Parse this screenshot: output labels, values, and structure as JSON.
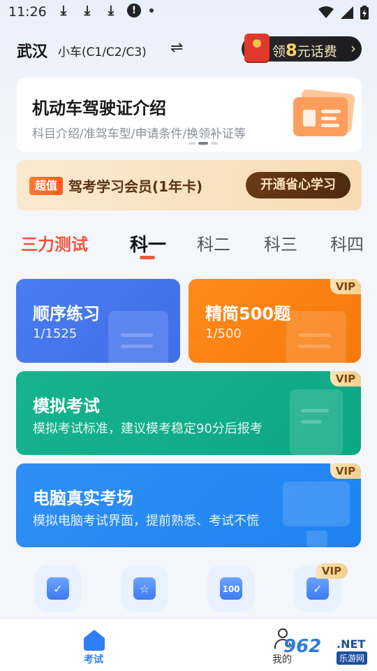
{
  "status_bar": {
    "time": "11:26"
  },
  "header": {
    "city": "武汉",
    "car_type": "小车(C1/C2/C3)",
    "swap_icon": "⇌",
    "reward": {
      "prefix": "领",
      "amount": "8",
      "suffix": "元话费",
      "arrow": "›"
    }
  },
  "banner": {
    "title": "机动车驾驶证介绍",
    "subtitle": "科目介绍/准驾车型/申请条件/换领补证等"
  },
  "vip_strip": {
    "badge": "超值",
    "title": "驾考学习会员(1年卡)",
    "button": "开通省心学习"
  },
  "tabs": {
    "items": [
      "三力测试",
      "科一",
      "科二",
      "科三",
      "科四"
    ],
    "active": "科一"
  },
  "practice": {
    "sequential": {
      "title": "顺序练习",
      "progress": "1/1525"
    },
    "concise": {
      "title": "精简500题",
      "progress": "1/500",
      "tag": "VIP"
    },
    "mock": {
      "title": "模拟考试",
      "subtitle": "模拟考试标准，建议模考稳定90分后报考",
      "tag": "VIP"
    },
    "computer": {
      "title": "电脑真实考场",
      "subtitle": "模拟电脑考试界面，提前熟悉、考试不慌",
      "tag": "VIP"
    }
  },
  "icon_row": {
    "items": [
      {
        "icon": "calendar-check-icon",
        "glyph": "✓"
      },
      {
        "icon": "star-bookmark-icon",
        "glyph": "☆"
      },
      {
        "icon": "score-100-icon",
        "glyph": "100"
      },
      {
        "icon": "clipboard-check-icon",
        "glyph": "✓"
      }
    ],
    "vip_tag": "VIP"
  },
  "bottom_nav": {
    "home_label": "考试",
    "me_label": "我的"
  },
  "watermark": {
    "logo": "962",
    "net": ".NET",
    "sub": "乐游网"
  },
  "colors": {
    "accent_red": "#f2563c",
    "blue_card": "#4b7cf2",
    "orange_card": "#ff8a1a",
    "green_card": "#16b48f",
    "sky_card": "#2f8ff5",
    "nav_active": "#2f7ef5"
  }
}
